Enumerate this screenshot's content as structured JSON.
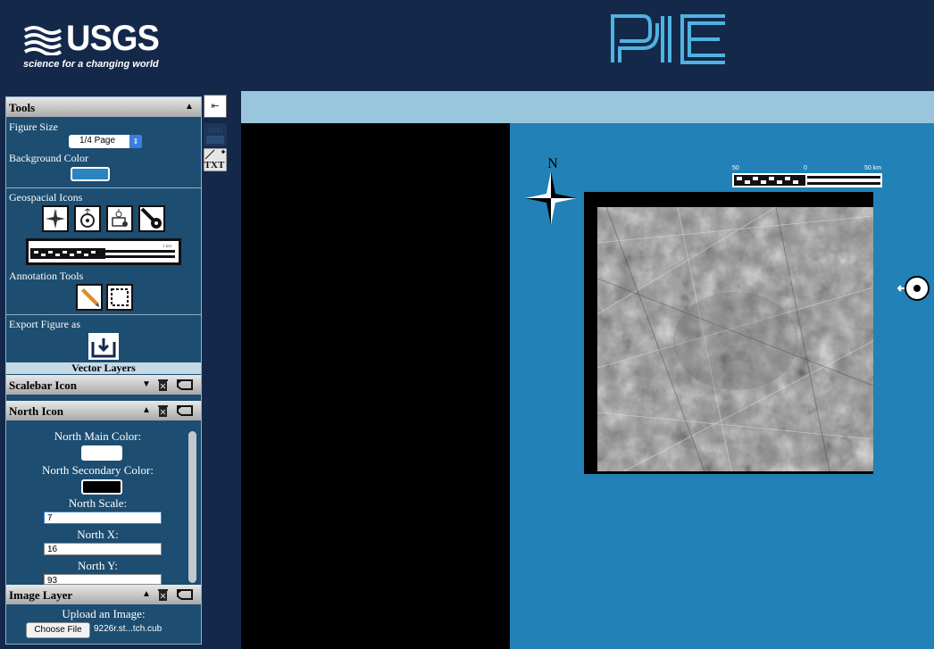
{
  "header": {
    "usgs_wordmark": "USGS",
    "usgs_tagline": "science for a changing world",
    "app_logo_text": "PIE"
  },
  "tools": {
    "title": "Tools",
    "figure_size_label": "Figure Size",
    "figure_size_value": "1/4 Page",
    "background_color_label": "Background Color",
    "background_color_value": "#2b84bd",
    "geospacial_label": "Geospacial Icons",
    "geo_icons": [
      "north-arrow-icon",
      "sun-direction-icon",
      "observer-icon",
      "sun-icon"
    ],
    "scalebar_preview_label": "1 km",
    "annotation_label": "Annotation Tools",
    "annotation_icons": [
      "pencil-icon",
      "selection-box-icon"
    ],
    "export_label": "Export Figure as"
  },
  "vector_layers": {
    "title": "Vector Layers",
    "layers": [
      {
        "name": "Scalebar Icon",
        "expanded": false
      },
      {
        "name": "North Icon",
        "expanded": true
      }
    ]
  },
  "north_settings": {
    "main_color_label": "North Main Color:",
    "main_color_value": "#ffffff",
    "secondary_color_label": "North Secondary Color:",
    "secondary_color_value": "#000000",
    "scale_label": "North Scale:",
    "scale_value": "7",
    "x_label": "North X:",
    "x_value": "16",
    "y_label": "North Y:",
    "y_value": "93"
  },
  "image_layer": {
    "title": "Image Layer",
    "upload_label": "Upload an Image:",
    "choose_button": "Choose File",
    "file_name": "9226r.st...tch.cub"
  },
  "figure": {
    "north_letter": "N",
    "scalebar_labels": [
      "50",
      "0",
      "50 km"
    ],
    "background_color": "#2281b6"
  },
  "colors": {
    "header_bg": "#14284a",
    "panel_bg": "#1d4d70",
    "map_topbar": "#99c6dc"
  }
}
